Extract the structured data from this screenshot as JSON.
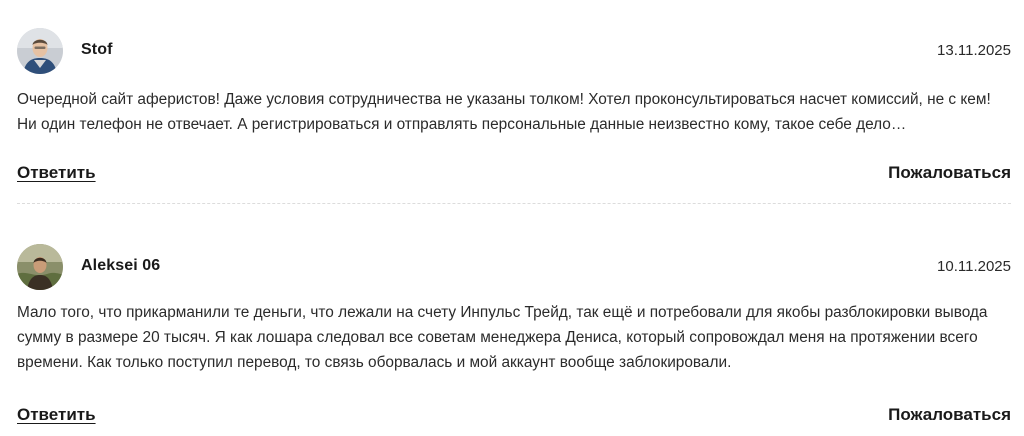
{
  "comments": [
    {
      "author": "Stof",
      "date": "13.11.2025",
      "avatar": "avatar-man-dark-hoodie",
      "text": "Очередной сайт аферистов! Даже условия сотрудничества не указаны толком! Хотел проконсультироваться насчет комиссий, не с кем! Ни один телефон не отвечает. А регистрироваться и отправлять персональные данные неизвестно кому, такое себе дело…",
      "reply_label": "Ответить",
      "report_label": "Пожаловаться"
    },
    {
      "author": "Aleksei 06",
      "date": "10.11.2025",
      "avatar": "avatar-man-outdoors",
      "text": "Мало того, что прикарманили те деньги, что лежали на счету Инпульс Трейд, так ещё и потребовали для якобы разблокировки вывода сумму в размере 20 тысяч. Я как лошара следовал все советам менеджера Дениса, который сопровождал меня на протяжении всего времени. Как только поступил перевод, то связь оборвалась и мой аккаунт вообще заблокировали.",
      "reply_label": "Ответить",
      "report_label": "Пожаловаться"
    }
  ],
  "colors": {
    "text": "#2b2b2b",
    "divider": "#dcdcdc",
    "background": "#ffffff"
  }
}
